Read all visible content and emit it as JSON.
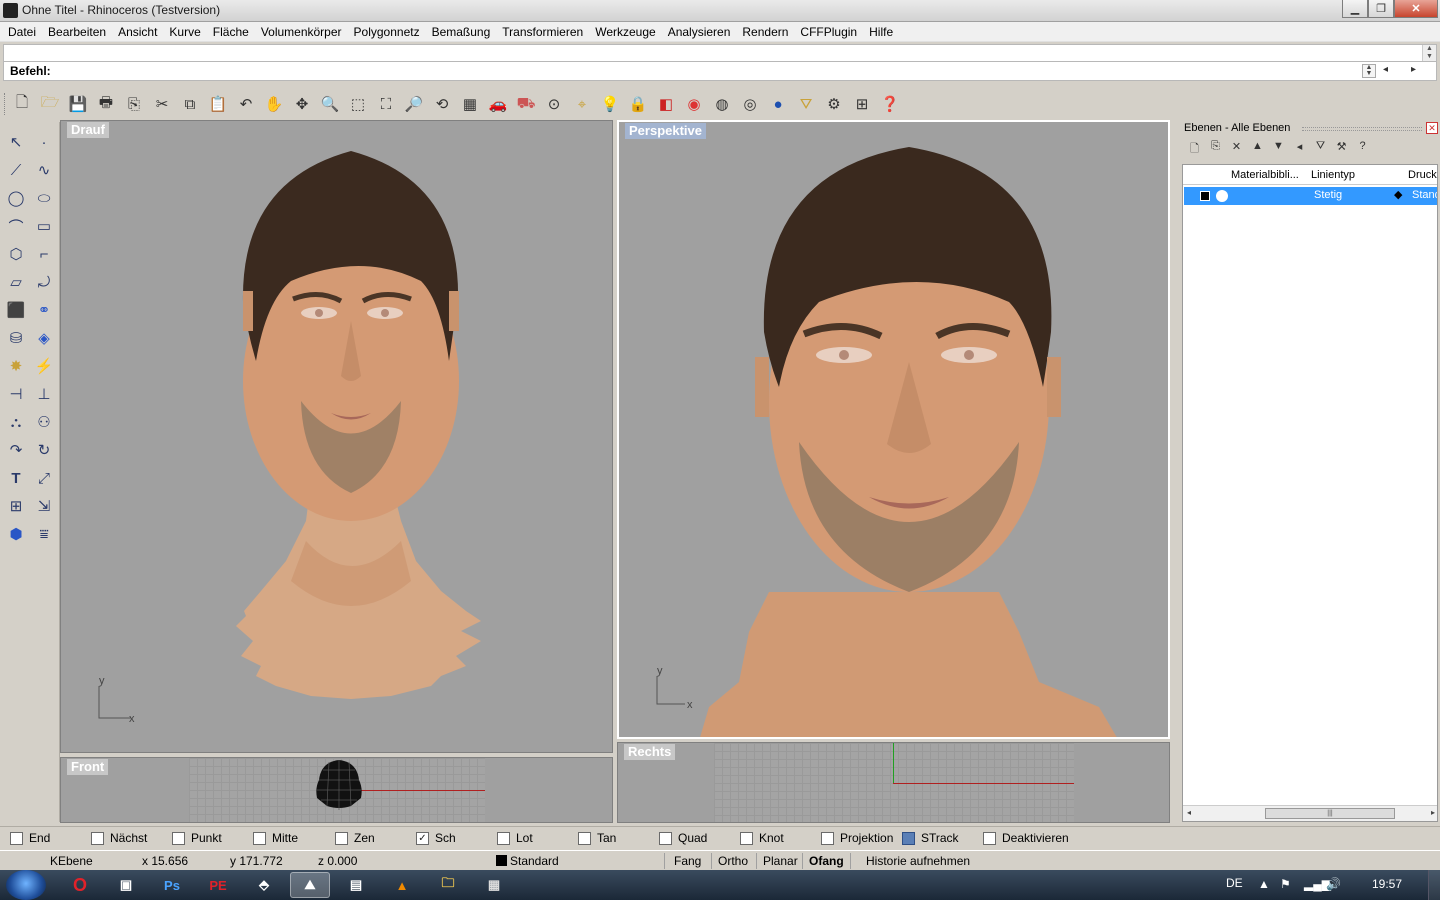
{
  "window": {
    "title": "Ohne Titel - Rhinoceros (Testversion)",
    "minimize": "▁",
    "maximize": "❐",
    "close": "✕"
  },
  "menu": [
    "Datei",
    "Bearbeiten",
    "Ansicht",
    "Kurve",
    "Fläche",
    "Volumenkörper",
    "Polygonnetz",
    "Bemaßung",
    "Transformieren",
    "Werkzeuge",
    "Analysieren",
    "Rendern",
    "CFFPlugin",
    "Hilfe"
  ],
  "command": {
    "label": "Befehl:",
    "value": ""
  },
  "viewports": {
    "top": {
      "label": "Drauf",
      "axis_y": "y",
      "axis_x": "x"
    },
    "perspective": {
      "label": "Perspektive",
      "axis_y": "y",
      "axis_x": "x"
    },
    "front": {
      "label": "Front"
    },
    "right": {
      "label": "Rechts"
    }
  },
  "layers_panel": {
    "title": "Ebenen - Alle Ebenen",
    "columns": [
      "Materialbibli...",
      "Linientyp",
      "Druck"
    ],
    "rows": [
      {
        "linetype": "Stetig",
        "print": "Stand",
        "selected": true
      }
    ]
  },
  "osnaps": [
    {
      "label": "End",
      "checked": false
    },
    {
      "label": "Nächst",
      "checked": false
    },
    {
      "label": "Punkt",
      "checked": false
    },
    {
      "label": "Mitte",
      "checked": false
    },
    {
      "label": "Zen",
      "checked": false
    },
    {
      "label": "Sch",
      "checked": true
    },
    {
      "label": "Lot",
      "checked": false
    },
    {
      "label": "Tan",
      "checked": false
    },
    {
      "label": "Quad",
      "checked": false
    },
    {
      "label": "Knot",
      "checked": false
    },
    {
      "label": "Projektion",
      "checked": false
    },
    {
      "label": "STrack",
      "checked": false
    },
    {
      "label": "Deaktivieren",
      "checked": false
    }
  ],
  "status": {
    "cplane": "KEbene",
    "x": "x 15.656",
    "y": "y 171.772",
    "z": "z 0.000",
    "layer": "Standard",
    "snap": "Fang",
    "ortho": "Ortho",
    "planar": "Planar",
    "osnap": "Ofang",
    "history": "Historie aufnehmen"
  },
  "taskbar": {
    "lang": "DE",
    "time": "19:57",
    "apps": [
      "opera",
      "remote",
      "Ps",
      "PE",
      "tool",
      "rhino",
      "notes",
      "vlc",
      "explorer",
      "app"
    ]
  }
}
